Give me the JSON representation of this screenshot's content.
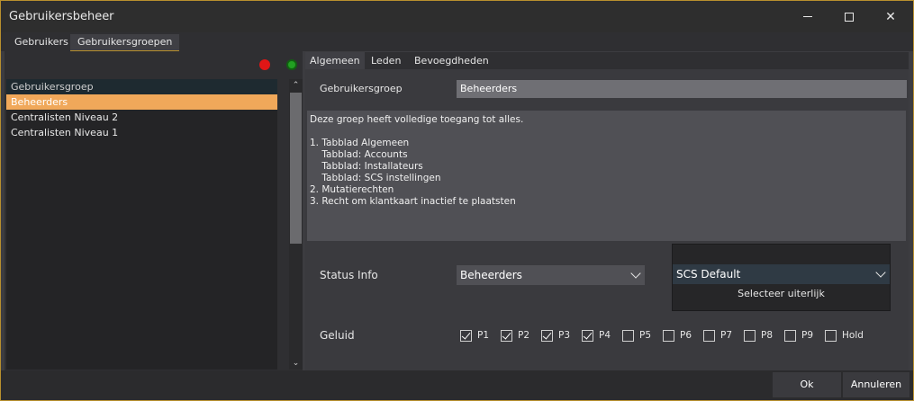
{
  "window": {
    "title": "Gebruikersbeheer"
  },
  "top_tabs": [
    {
      "label": "Gebruikers",
      "active": false
    },
    {
      "label": "Gebruikersgroepen",
      "active": true
    }
  ],
  "left": {
    "list_header": "Gebruikersgroep",
    "items": [
      {
        "label": "Beheerders",
        "selected": true
      },
      {
        "label": "Centralisten Niveau 2",
        "selected": false
      },
      {
        "label": "Centralisten Niveau 1",
        "selected": false
      }
    ]
  },
  "right_tabs": [
    {
      "label": "Algemeen",
      "active": true
    },
    {
      "label": "Leden",
      "active": false
    },
    {
      "label": "Bevoegdheden",
      "active": false
    }
  ],
  "form": {
    "group_label": "Gebruikersgroep",
    "group_value": "Beheerders",
    "description": "Deze groep heeft volledige toegang tot alles.\n\n1. Tabblad Algemeen\n    Tabblad: Accounts\n    Tabblad: Installateurs\n    Tabblad: SCS instellingen\n2. Mutatierechten\n3. Recht om klantkaart inactief te plaatsten",
    "status_label": "Status Info",
    "status_value": "Beheerders",
    "look_value": "SCS Default",
    "look_button": "Selecteer uiterlijk",
    "sound_label": "Geluid",
    "sounds": [
      {
        "label": "P1",
        "checked": true
      },
      {
        "label": "P2",
        "checked": true
      },
      {
        "label": "P3",
        "checked": true
      },
      {
        "label": "P4",
        "checked": true
      },
      {
        "label": "P5",
        "checked": false
      },
      {
        "label": "P6",
        "checked": false
      },
      {
        "label": "P7",
        "checked": false
      },
      {
        "label": "P8",
        "checked": false
      },
      {
        "label": "P9",
        "checked": false
      },
      {
        "label": "Hold",
        "checked": false
      }
    ]
  },
  "buttons": {
    "ok": "Ok",
    "cancel": "Annuleren"
  },
  "colors": {
    "accent": "#f0a85a",
    "border": "#b8902e",
    "delete_icon": "#e01616",
    "add_icon": "#22a022"
  }
}
